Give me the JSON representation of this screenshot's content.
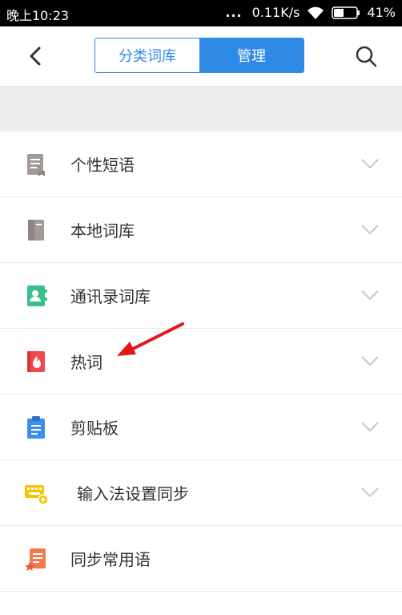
{
  "status_bar": {
    "time": "晚上10:23",
    "signal_dots": "...",
    "network_speed": "0.11K/s",
    "battery_percent": "41%"
  },
  "header": {
    "back_icon": "chevron-left-icon",
    "search_icon": "search-icon",
    "tabs": [
      {
        "label": "分类词库",
        "active": false
      },
      {
        "label": "管理",
        "active": true
      }
    ]
  },
  "list": {
    "items": [
      {
        "label": "个性短语",
        "icon": "document-icon",
        "icon_color": "#a39996",
        "expandable": true
      },
      {
        "label": "本地词库",
        "icon": "book-icon",
        "icon_color": "#a39996",
        "expandable": true
      },
      {
        "label": "通讯录词库",
        "icon": "contacts-book-icon",
        "icon_color": "#3bbf8a",
        "expandable": true
      },
      {
        "label": "热词",
        "icon": "flame-book-icon",
        "icon_color": "#ef4848",
        "expandable": true
      },
      {
        "label": "剪贴板",
        "icon": "clipboard-icon",
        "icon_color": "#3a8fe8",
        "expandable": true
      },
      {
        "label": "输入法设置同步",
        "icon": "keyboard-sync-icon",
        "icon_color": "#f5c400",
        "expandable": true
      },
      {
        "label": "同步常用语",
        "icon": "star-note-icon",
        "icon_color": "#f27a4e",
        "expandable": false
      }
    ]
  },
  "annotation": {
    "icon": "red-arrow-icon",
    "color": "#e8141b"
  },
  "colors": {
    "accent": "#2f8ae6",
    "band": "#eeeeee"
  }
}
